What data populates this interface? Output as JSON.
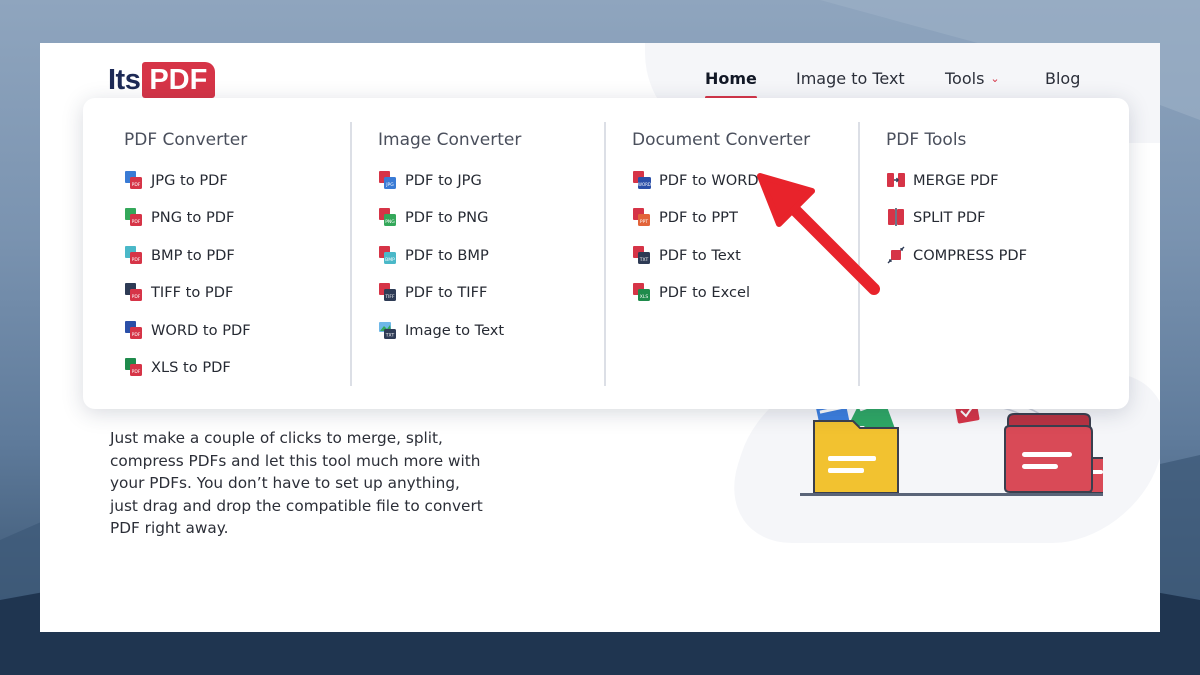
{
  "logo": {
    "part1": "Its",
    "part2": "PDF"
  },
  "nav": {
    "home": "Home",
    "image_to_text": "Image to Text",
    "tools": "Tools",
    "blog": "Blog"
  },
  "dropdown": {
    "columns": [
      {
        "title": "PDF Converter",
        "items": [
          "JPG to PDF",
          "PNG to PDF",
          "BMP to PDF",
          "TIFF to PDF",
          "WORD to PDF",
          "XLS to PDF"
        ]
      },
      {
        "title": "Image Converter",
        "items": [
          "PDF to JPG",
          "PDF to PNG",
          "PDF to BMP",
          "PDF to TIFF",
          "Image to Text"
        ]
      },
      {
        "title": "Document Converter",
        "items": [
          "PDF to WORD",
          "PDF to PPT",
          "PDF to Text",
          "PDF to Excel"
        ]
      },
      {
        "title": "PDF Tools",
        "items": [
          "MERGE PDF",
          "SPLIT PDF",
          "COMPRESS PDF"
        ]
      }
    ]
  },
  "hero": {
    "description": "Just make a couple of clicks to merge, split, compress PDFs and let this tool much more with your PDFs. You don’t have to set up anything, just drag and drop the compatible file to convert PDF right away."
  },
  "colors": {
    "brand_red": "#d63447",
    "brand_navy": "#1d2a56",
    "folder_yellow": "#f2c230",
    "folder_red": "#d94a57",
    "annotation_arrow": "#e8232b"
  },
  "icons": {
    "tools_chevron": "chevron-down-icon",
    "annotation": "red-arrow-pointer"
  }
}
